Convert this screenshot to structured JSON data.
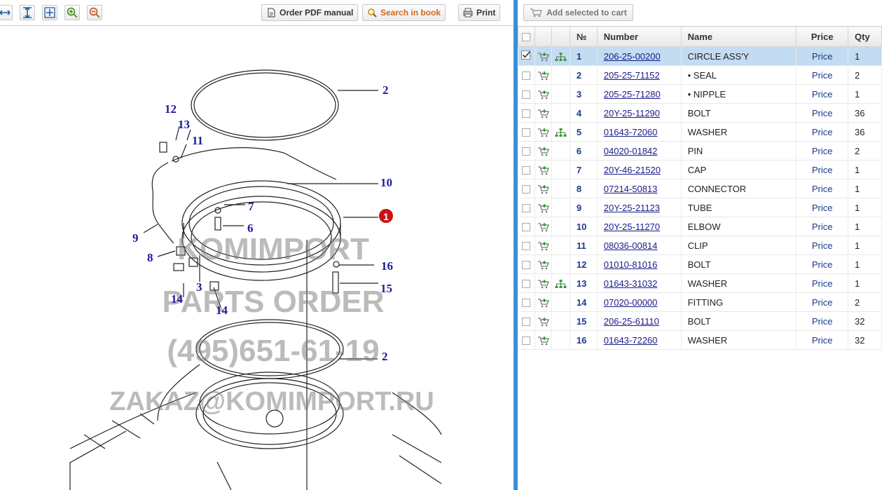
{
  "toolbar": {
    "order_pdf_label": "Order PDF manual",
    "search_label": "Search in book",
    "print_label": "Print"
  },
  "diagram": {
    "callouts": [
      "2",
      "12",
      "13",
      "11",
      "10",
      "7",
      "1",
      "6",
      "9",
      "8",
      "16",
      "15",
      "3",
      "14",
      "14",
      "2"
    ],
    "watermark": {
      "line1": "KOMIMPORT",
      "line2": "PARTS ORDER",
      "line3": "(495)651-61-19",
      "line4": "ZAKAZ@KOMIMPORT.RU"
    }
  },
  "cart": {
    "add_selected_label": "Add selected to cart"
  },
  "table": {
    "headers": {
      "no": "№",
      "number": "Number",
      "name": "Name",
      "price": "Price",
      "qty": "Qty"
    },
    "rows": [
      {
        "no": "1",
        "number": "206-25-00200",
        "name": "CIRCLE ASS'Y",
        "price": "Price",
        "qty": "1",
        "checked": true,
        "tree": true
      },
      {
        "no": "2",
        "number": "205-25-71152",
        "name": "• SEAL",
        "price": "Price",
        "qty": "2",
        "checked": false,
        "tree": false
      },
      {
        "no": "3",
        "number": "205-25-71280",
        "name": "• NIPPLE",
        "price": "Price",
        "qty": "1",
        "checked": false,
        "tree": false
      },
      {
        "no": "4",
        "number": "20Y-25-11290",
        "name": "BOLT",
        "price": "Price",
        "qty": "36",
        "checked": false,
        "tree": false
      },
      {
        "no": "5",
        "number": "01643-72060",
        "name": "WASHER",
        "price": "Price",
        "qty": "36",
        "checked": false,
        "tree": true
      },
      {
        "no": "6",
        "number": "04020-01842",
        "name": "PIN",
        "price": "Price",
        "qty": "2",
        "checked": false,
        "tree": false
      },
      {
        "no": "7",
        "number": "20Y-46-21520",
        "name": "CAP",
        "price": "Price",
        "qty": "1",
        "checked": false,
        "tree": false
      },
      {
        "no": "8",
        "number": "07214-50813",
        "name": "CONNECTOR",
        "price": "Price",
        "qty": "1",
        "checked": false,
        "tree": false
      },
      {
        "no": "9",
        "number": "20Y-25-21123",
        "name": "TUBE",
        "price": "Price",
        "qty": "1",
        "checked": false,
        "tree": false
      },
      {
        "no": "10",
        "number": "20Y-25-11270",
        "name": "ELBOW",
        "price": "Price",
        "qty": "1",
        "checked": false,
        "tree": false
      },
      {
        "no": "11",
        "number": "08036-00814",
        "name": "CLIP",
        "price": "Price",
        "qty": "1",
        "checked": false,
        "tree": false
      },
      {
        "no": "12",
        "number": "01010-81016",
        "name": "BOLT",
        "price": "Price",
        "qty": "1",
        "checked": false,
        "tree": false
      },
      {
        "no": "13",
        "number": "01643-31032",
        "name": "WASHER",
        "price": "Price",
        "qty": "1",
        "checked": false,
        "tree": true
      },
      {
        "no": "14",
        "number": "07020-00000",
        "name": "FITTING",
        "price": "Price",
        "qty": "2",
        "checked": false,
        "tree": false
      },
      {
        "no": "15",
        "number": "206-25-61110",
        "name": "BOLT",
        "price": "Price",
        "qty": "32",
        "checked": false,
        "tree": false
      },
      {
        "no": "16",
        "number": "01643-72260",
        "name": "WASHER",
        "price": "Price",
        "qty": "32",
        "checked": false,
        "tree": false
      }
    ]
  },
  "colors": {
    "divider": "#3a8fd6",
    "selected_row": "#c3dcf2",
    "link": "#1a1a8a",
    "callout": "#1c1c9c",
    "marker": "#cc1111"
  }
}
